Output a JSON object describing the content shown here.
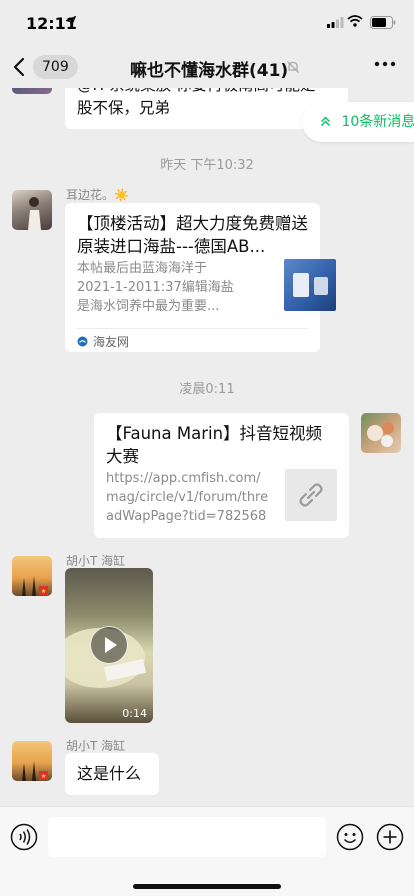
{
  "status_bar": {
    "time": "12:11"
  },
  "nav": {
    "unread_count": "709",
    "title": "嘛也不懂海水群(41)"
  },
  "new_messages_pill": "10条新消息",
  "messages": {
    "partial_text": {
      "line1": "@H 系统案放 你要再极南高可能是",
      "line2": "股不保，兄弟"
    },
    "time1": "昨天 下午10:32",
    "msg1": {
      "sender": "耳边花。☀️",
      "card_title": "【顶楼活动】超大力度免费赠送原装进口海盐---德国AB...",
      "card_desc": "本帖最后由蓝海海洋于 2021-1-2011:37编辑海盐是海水饲养中最为重要...",
      "card_source": "海友网"
    },
    "time2": "凌晨0:11",
    "msg2": {
      "card_title": "【Fauna Marin】抖音短视频大赛",
      "card_desc": "https://app.cmfish.com/mag/circle/v1/forum/threadWapPage?tid=782568&..."
    },
    "msg3": {
      "sender": "胡小T 海缸",
      "video_duration": "0:14"
    },
    "msg4": {
      "sender": "胡小T 海缸",
      "text": "这是什么"
    }
  },
  "input": {
    "value": "",
    "placeholder": ""
  },
  "colors": {
    "accent": "#07c160",
    "background": "#ededed",
    "bubble": "#ffffff"
  }
}
